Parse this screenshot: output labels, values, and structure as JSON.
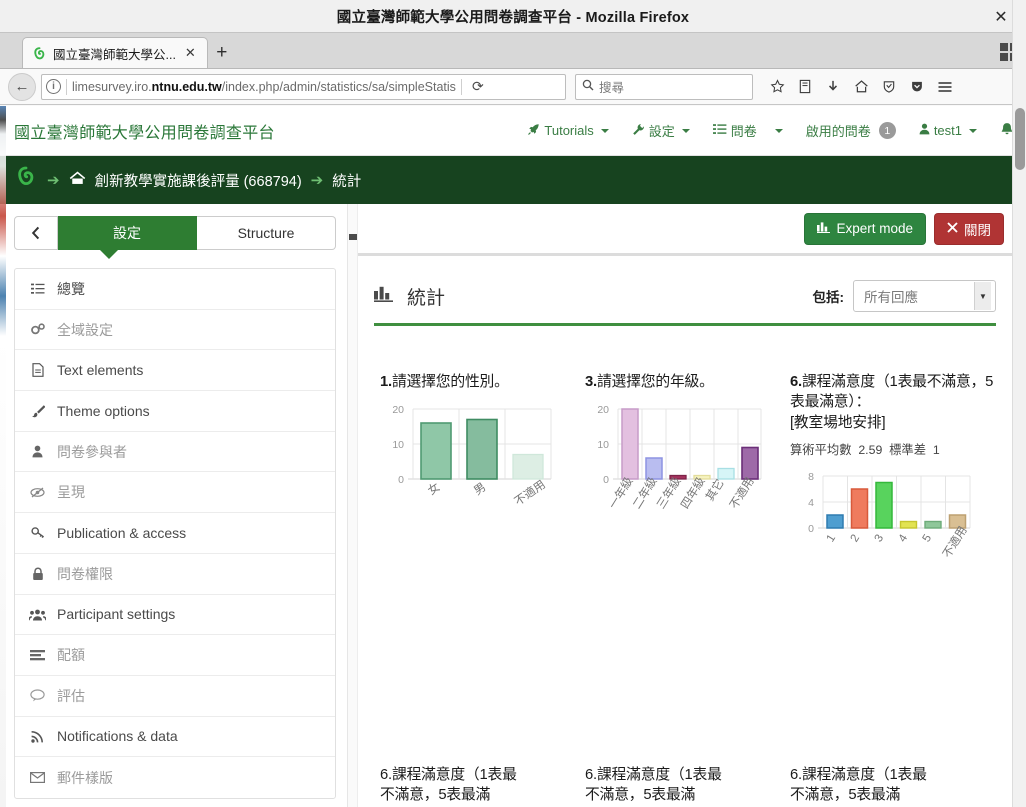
{
  "browser": {
    "window_title": "國立臺灣師範大學公用問卷調查平台 - Mozilla Firefox",
    "close_glyph": "✕",
    "tab": {
      "label": "國立臺灣師範大學公...",
      "close_glyph": "✕",
      "favicon_name": "limesurvey-favicon"
    },
    "new_tab_glyph": "+",
    "url_prefix": "limesurvey.iro.",
    "url_domain": "ntnu.edu.tw",
    "url_suffix": "/index.php/admin/statistics/sa/simpleStatis",
    "reload_glyph": "⟳",
    "back_glyph": "←",
    "search_placeholder": "搜尋",
    "search_icon": "search-icon",
    "toolbar_icons": [
      "star-icon",
      "library-icon",
      "download-icon",
      "home-icon",
      "shield-icon",
      "pocket-icon",
      "menu-icon"
    ]
  },
  "ls_navbar": {
    "brand": "國立臺灣師範大學公用問卷調查平台",
    "items": [
      {
        "label": "Tutorials",
        "icon": "rocket-icon",
        "caret": true
      },
      {
        "label": "設定",
        "icon": "wrench-icon",
        "caret": true
      },
      {
        "label": "問卷",
        "icon": "list-icon",
        "caret": true
      },
      {
        "label": "啟用的問卷",
        "icon": "",
        "badge": "1",
        "caret": false
      },
      {
        "label": "test1",
        "icon": "user-icon",
        "caret": true
      },
      {
        "label": "",
        "icon": "bell-icon",
        "caret": false
      }
    ]
  },
  "breadcrumb": {
    "logo": "limesurvey-logo",
    "arrow": "➔",
    "home_icon": "home-icon",
    "survey": "創新教學實施課後評量 (668794)",
    "current": "統計"
  },
  "sidebar": {
    "collapse_icon": "chevron-left-icon",
    "tabs": [
      {
        "label": "設定",
        "active": true
      },
      {
        "label": "Structure",
        "active": false
      }
    ],
    "items": [
      {
        "label": "總覽",
        "icon": "list-icon",
        "muted": false
      },
      {
        "label": "全域設定",
        "icon": "gears-icon",
        "muted": true
      },
      {
        "label": "Text elements",
        "icon": "file-icon",
        "muted": false
      },
      {
        "label": "Theme options",
        "icon": "brush-icon",
        "muted": false
      },
      {
        "label": "問卷參與者",
        "icon": "user-icon",
        "muted": true
      },
      {
        "label": "呈現",
        "icon": "eye-slash-icon",
        "muted": true
      },
      {
        "label": "Publication & access",
        "icon": "key-icon",
        "muted": false
      },
      {
        "label": "問卷權限",
        "icon": "lock-icon",
        "muted": true
      },
      {
        "label": "Participant settings",
        "icon": "users-icon",
        "muted": false
      },
      {
        "label": "配額",
        "icon": "bars-icon",
        "muted": true
      },
      {
        "label": "評估",
        "icon": "comment-icon",
        "muted": true
      },
      {
        "label": "Notifications & data",
        "icon": "rss-icon",
        "muted": false
      },
      {
        "label": "郵件樣版",
        "icon": "envelope-icon",
        "muted": true
      }
    ]
  },
  "toolbar": {
    "expert_mode_label": "Expert mode",
    "expert_mode_icon": "bar-chart-icon",
    "close_label": "關閉",
    "close_icon": "times-icon"
  },
  "stats": {
    "title": "統計",
    "title_icon": "bar-chart-icon",
    "include_label": "包括:",
    "include_value": "所有回應",
    "include_options": [
      "所有回應"
    ]
  },
  "chart_data": [
    {
      "type": "bar",
      "title": "1.請選擇您的性別。",
      "question_number": "1.",
      "question_text": "請選擇您的性別。",
      "categories": [
        "女",
        "男",
        "不適用"
      ],
      "values": [
        16,
        17,
        7
      ],
      "colors": [
        "#8fc7a7",
        "#85bc9e",
        "#ddeee4"
      ],
      "border_colors": [
        "#4f9a72",
        "#3f8c62",
        "#b9d9c8"
      ],
      "ylim": [
        0,
        22
      ],
      "yticks": [
        0,
        10,
        20
      ],
      "xlabel": "",
      "ylabel": "",
      "grid": true
    },
    {
      "type": "bar",
      "title": "3.請選擇您的年級。",
      "question_number": "3.",
      "question_text": "請選擇您的年級。",
      "categories": [
        "一年級",
        "二年級",
        "三年級",
        "四年級",
        "其它",
        "不適用"
      ],
      "values": [
        20,
        6,
        1,
        1,
        3,
        9
      ],
      "colors": [
        "#e3c0e0",
        "#b9bdf0",
        "#a5335e",
        "#f6f3c0",
        "#d6f5f7",
        "#9e6aa8"
      ],
      "border_colors": [
        "#c79cc8",
        "#8d93e2",
        "#7d2348",
        "#e3dd9b",
        "#a8dfe4",
        "#6b2f78"
      ],
      "ylim": [
        0,
        22
      ],
      "yticks": [
        0,
        10,
        20
      ],
      "xlabel": "",
      "ylabel": "",
      "grid": true
    },
    {
      "type": "bar",
      "title": "6.課程滿意度（1表最不滿意，5表最滿意）：\n[教室場地安排]",
      "question_number": "6.",
      "question_text": "課程滿意度（1表最不滿意，5表最滿意）：",
      "subject": "[教室場地安排]",
      "mean_label": "算術平均數",
      "mean_value": "2.59",
      "sd_label": "標準差",
      "sd_value": "1",
      "categories": [
        "1",
        "2",
        "3",
        "4",
        "5",
        "不適用"
      ],
      "values": [
        2,
        6,
        7,
        1,
        1,
        2
      ],
      "colors": [
        "#4f9ed0",
        "#ef7b5e",
        "#58d35d",
        "#e2e352",
        "#8fc79a",
        "#d9bf93"
      ],
      "border_colors": [
        "#2e7cb0",
        "#d85a3b",
        "#34b83b",
        "#c5c62f",
        "#6dab79",
        "#bda071"
      ],
      "ylim": [
        0,
        8.6
      ],
      "yticks": [
        0,
        4,
        8
      ],
      "xlabel": "",
      "ylabel": "",
      "grid": true
    }
  ],
  "bottom_charts": [
    {
      "line1": "6.課程滿意度（1表最",
      "line2": "不滿意，5表最滿"
    },
    {
      "line1": "6.課程滿意度（1表最",
      "line2": "不滿意，5表最滿"
    },
    {
      "line1": "6.課程滿意度（1表最",
      "line2": "不滿意，5表最滿"
    }
  ]
}
